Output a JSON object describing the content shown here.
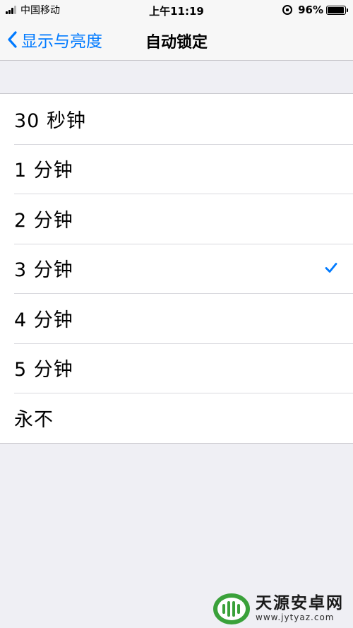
{
  "status_bar": {
    "carrier": "中国移动",
    "time": "上午11:19",
    "battery_percent": "96%",
    "battery_level": 0.96,
    "signal_icon": "signal-bars-icon",
    "rotation_lock_icon": "rotation-lock-icon"
  },
  "nav": {
    "back_label": "显示与亮度",
    "back_icon": "chevron-left-icon",
    "title": "自动锁定"
  },
  "options": [
    {
      "label": "30 秒钟",
      "selected": false
    },
    {
      "label": "1 分钟",
      "selected": false
    },
    {
      "label": "2 分钟",
      "selected": false
    },
    {
      "label": "3 分钟",
      "selected": true
    },
    {
      "label": "4 分钟",
      "selected": false
    },
    {
      "label": "5 分钟",
      "selected": false
    },
    {
      "label": "永不",
      "selected": false
    }
  ],
  "colors": {
    "accent": "#007aff",
    "background": "#efeff4"
  },
  "watermark": {
    "title": "天源安卓网",
    "url": "www.jytyaz.com"
  }
}
